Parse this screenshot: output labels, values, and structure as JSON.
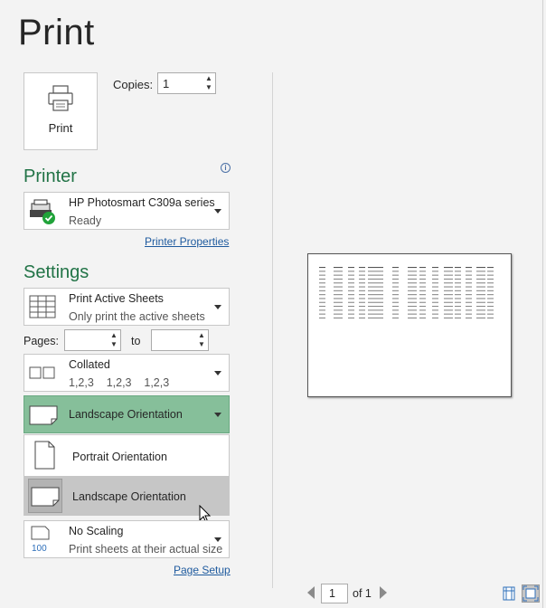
{
  "title": "Print",
  "print_button": {
    "label": "Print",
    "icon": "printer-icon"
  },
  "copies": {
    "label": "Copies:",
    "value": "1"
  },
  "printer": {
    "section_title": "Printer",
    "name": "HP Photosmart C309a series",
    "status": "Ready",
    "properties_link": "Printer Properties"
  },
  "settings": {
    "section_title": "Settings",
    "print_what": {
      "title": "Print Active Sheets",
      "subtitle": "Only print the active sheets"
    },
    "pages": {
      "label": "Pages:",
      "from": "",
      "to_label": "to",
      "to": ""
    },
    "collation": {
      "title": "Collated",
      "subtitle": "1,2,3    1,2,3    1,2,3"
    },
    "orientation": {
      "selected": "Landscape Orientation",
      "options": [
        "Portrait Orientation",
        "Landscape Orientation"
      ],
      "highlighted_index": 1
    },
    "scaling": {
      "title": "No Scaling",
      "subtitle": "Print sheets at their actual size",
      "icon_text": "100"
    },
    "page_setup_link": "Page Setup"
  },
  "preview": {
    "current_page": "1",
    "of_label": "of 1"
  },
  "colors": {
    "accent_green": "#217346",
    "selected_dropdown": "#86bf9a",
    "link_blue": "#1e5a9e"
  }
}
